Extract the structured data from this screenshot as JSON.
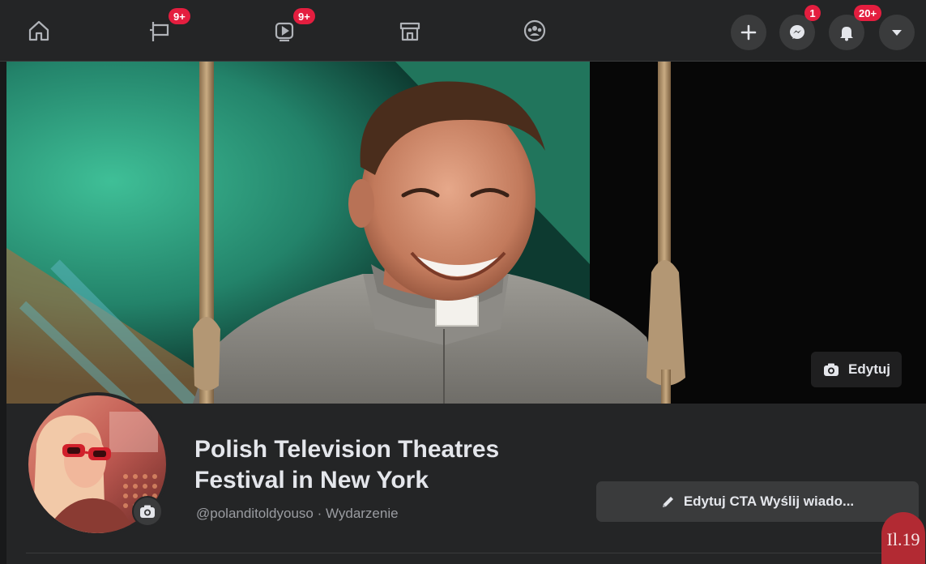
{
  "nav": {
    "items": [
      {
        "name": "home-icon",
        "badge": ""
      },
      {
        "name": "flag-icon",
        "badge": "9+"
      },
      {
        "name": "video-icon",
        "badge": "9+"
      },
      {
        "name": "marketplace-icon",
        "badge": ""
      },
      {
        "name": "groups-icon",
        "badge": ""
      }
    ],
    "actions": {
      "create_icon": "plus-icon",
      "messenger_badge": "1",
      "notifications_badge": "20+",
      "menu_icon": "caret-down-icon"
    }
  },
  "cover": {
    "edit_label": "Edytuj"
  },
  "profile": {
    "title": "Polish Television Theatres Festival in New York",
    "handle": "@polanditoldyouso",
    "separator": " · ",
    "category": "Wydarzenie",
    "cta_label": "Edytuj CTA Wyślij wiado..."
  },
  "stamp": {
    "text": "Il.19"
  },
  "colors": {
    "nav_bg": "#242526",
    "badge": "#e41e3f",
    "surface": "#3a3b3c",
    "text": "#e4e6eb",
    "muted_text": "#9a9ca1",
    "page_bg": "#18191a"
  }
}
